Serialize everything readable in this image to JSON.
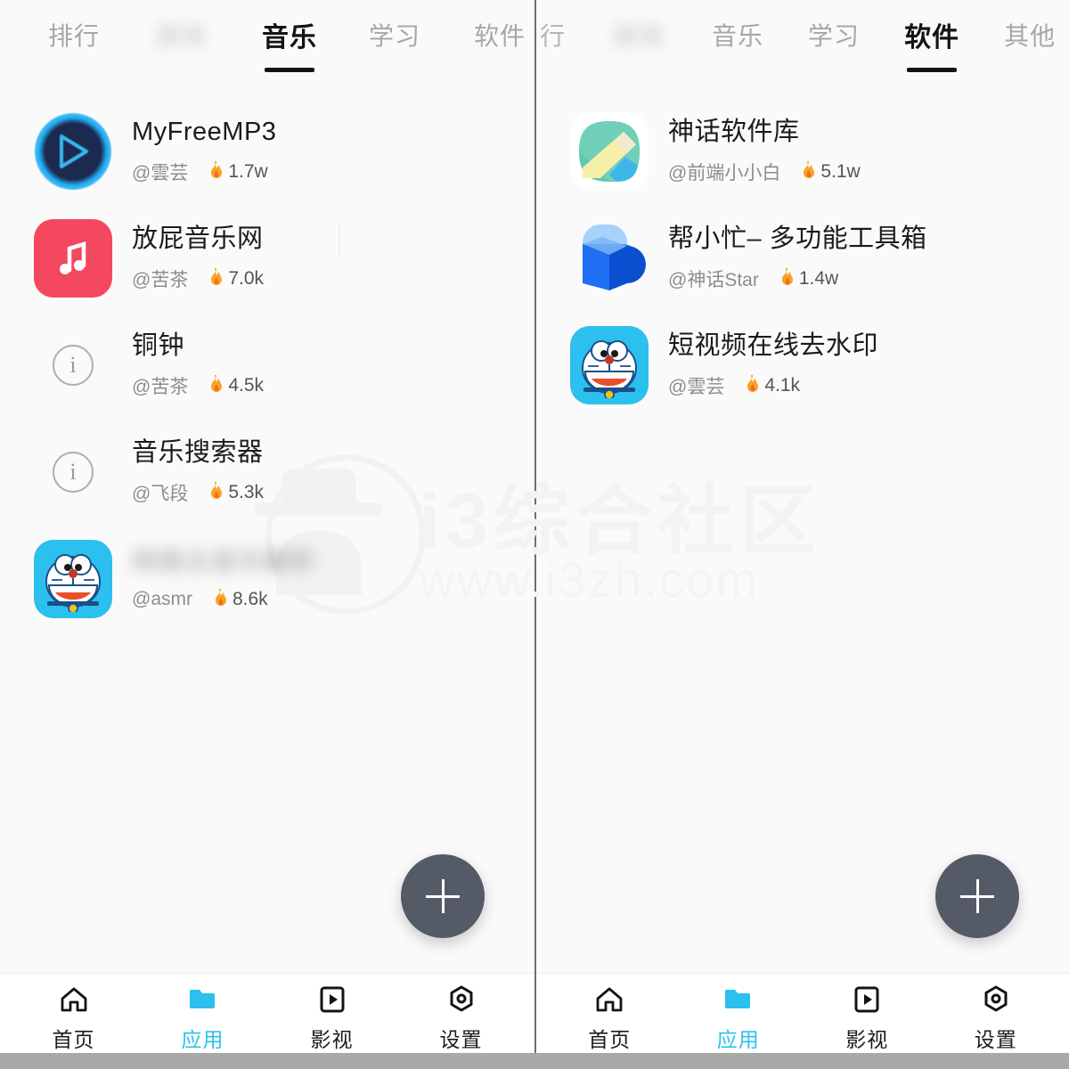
{
  "panels": [
    {
      "id": "left",
      "tabs": [
        {
          "label": "排行",
          "state": "normal",
          "name": "tab-ranking"
        },
        {
          "label": "游戏",
          "state": "blurred",
          "name": "tab-blurred"
        },
        {
          "label": "音乐",
          "state": "active",
          "name": "tab-music"
        },
        {
          "label": "学习",
          "state": "normal",
          "name": "tab-study"
        },
        {
          "label": "软件",
          "state": "normal",
          "name": "tab-software"
        }
      ],
      "items": [
        {
          "title": "MyFreeMP3",
          "author": "@雲芸",
          "hot": "1.7w",
          "icon": "mp3-play-icon",
          "blurred": false
        },
        {
          "title": "放屁音乐网",
          "author": "@苦茶",
          "hot": "7.0k",
          "icon": "music-note-icon",
          "blurred": false
        },
        {
          "title": "铜钟",
          "author": "@苦茶",
          "hot": "4.5k",
          "icon": "info-icon",
          "blurred": false
        },
        {
          "title": "音乐搜索器",
          "author": "@飞段",
          "hot": "5.3k",
          "icon": "info-icon",
          "blurred": false
        },
        {
          "title": "网易云音乐解析",
          "author": "@asmr",
          "hot": "8.6k",
          "icon": "doraemon-icon",
          "blurred": true
        }
      ]
    },
    {
      "id": "right",
      "tabs": [
        {
          "label": "行",
          "state": "clipped",
          "name": "tab-ranking-clipped"
        },
        {
          "label": "游戏",
          "state": "blurred",
          "name": "tab-blurred"
        },
        {
          "label": "音乐",
          "state": "normal",
          "name": "tab-music"
        },
        {
          "label": "学习",
          "state": "normal",
          "name": "tab-study"
        },
        {
          "label": "软件",
          "state": "active",
          "name": "tab-software"
        },
        {
          "label": "其他",
          "state": "normal",
          "name": "tab-other"
        }
      ],
      "items": [
        {
          "title": "神话软件库",
          "author": "@前端小小白",
          "hot": "5.1w",
          "icon": "myth-pencil-icon",
          "blurred": false
        },
        {
          "title": "帮小忙– 多功能工具箱",
          "author": "@神话Star",
          "hot": "1.4w",
          "icon": "bang-cube-icon",
          "blurred": false
        },
        {
          "title": "短视频在线去水印",
          "author": "@雲芸",
          "hot": "4.1k",
          "icon": "doraemon-icon",
          "blurred": false
        }
      ]
    }
  ],
  "fab": {
    "label": "+",
    "name": "add-button"
  },
  "bottom_nav": {
    "items": [
      {
        "label": "首页",
        "icon": "home-icon",
        "active": false
      },
      {
        "label": "应用",
        "icon": "folder-icon",
        "active": true
      },
      {
        "label": "影视",
        "icon": "video-icon",
        "active": false
      },
      {
        "label": "设置",
        "icon": "settings-icon",
        "active": false
      }
    ]
  },
  "watermark": {
    "title": "i3综合社区",
    "url": "www.i3zh.com"
  },
  "colors": {
    "accent": "#2cc0ee",
    "fab": "#555a67",
    "tab_active": "#141414",
    "tab_inactive": "#a7a7a7",
    "background": "#fafafa",
    "music_icon": "#f4485e"
  }
}
